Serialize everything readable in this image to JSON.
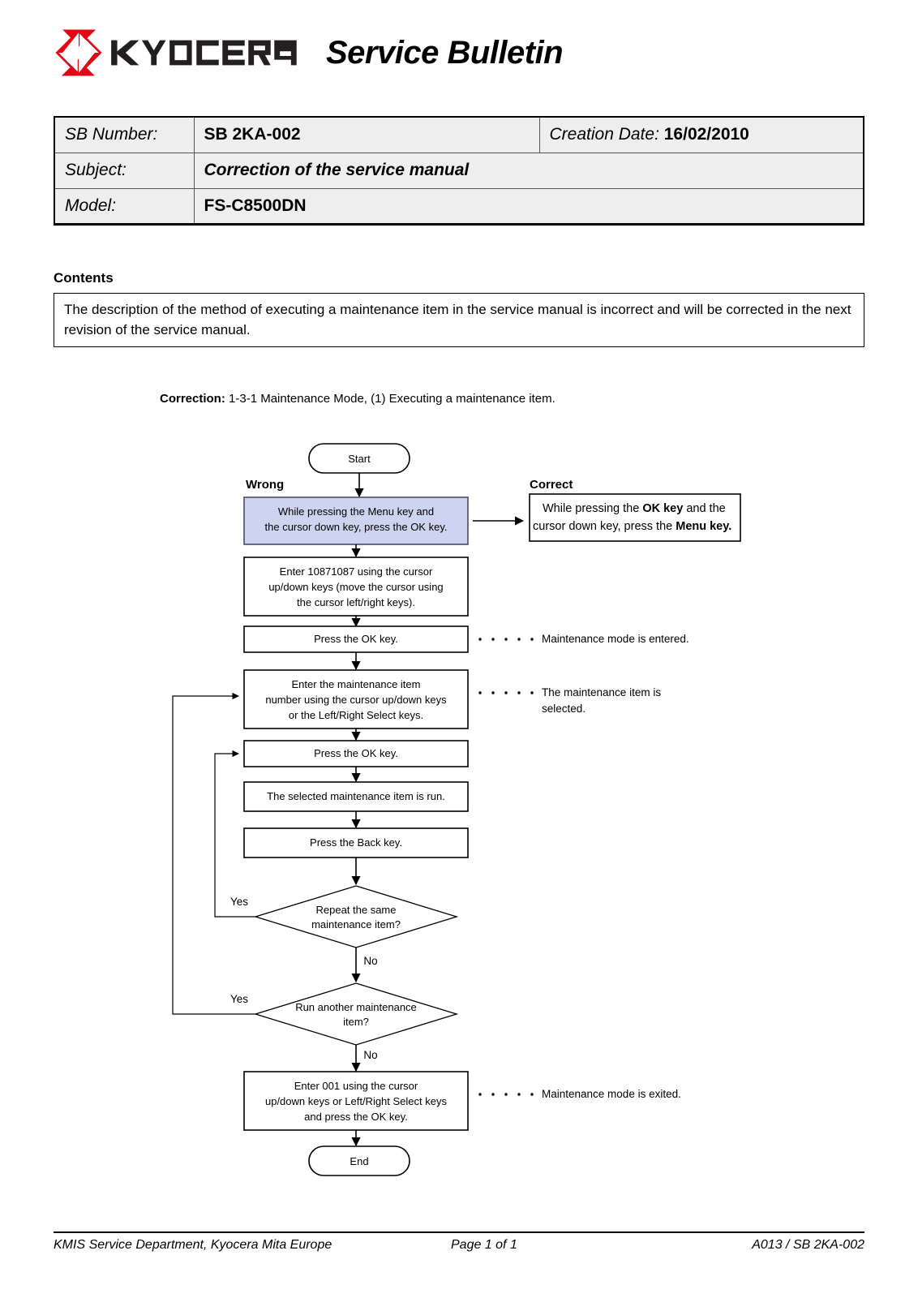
{
  "header": {
    "logo_name": "KYOCERA",
    "logo_color": "#e30613",
    "title": "Service Bulletin"
  },
  "info": {
    "sb_number_label": "SB Number:",
    "sb_number_value": "SB 2KA-002",
    "creation_date_label": "Creation Date:",
    "creation_date_value": "16/02/2010",
    "subject_label": "Subject:",
    "subject_value": "Correction of the service manual",
    "model_label": "Model:",
    "model_value": "FS-C8500DN"
  },
  "contents": {
    "heading": "Contents",
    "body": "The description of the method of executing a maintenance item in the service manual is incorrect and will be corrected in the next revision of the service manual."
  },
  "correction": {
    "label": "Correction:",
    "text": "1-3-1 Maintenance Mode, (1) Executing a maintenance item."
  },
  "flowchart": {
    "wrong_header": "Wrong",
    "correct_header": "Correct",
    "start_label": "Start",
    "end_label": "End",
    "wrong_box": {
      "line1": "While pressing the Menu key and",
      "line2": "the cursor down key, press the OK key.",
      "fill": "#ccd4f0"
    },
    "correct_box": {
      "line1_a": "While pressing the ",
      "line1_b": "OK key",
      "line1_c": " and the",
      "line2_a": "cursor down key, press the ",
      "line2_b": "Menu key."
    },
    "steps": [
      {
        "id": "enter-code",
        "lines": [
          "Enter 10871087 using the cursor",
          "up/down keys (move the cursor using",
          "the cursor left/right keys)."
        ]
      },
      {
        "id": "press-ok-1",
        "lines": [
          "Press the OK key."
        ],
        "note": [
          "Maintenance mode is entered."
        ]
      },
      {
        "id": "enter-item-number",
        "lines": [
          "Enter the maintenance item",
          "number using the cursor up/down keys",
          "or the Left/Right Select keys."
        ],
        "note": [
          "The maintenance item is",
          "selected."
        ]
      },
      {
        "id": "press-ok-2",
        "lines": [
          "Press the OK key."
        ]
      },
      {
        "id": "item-runs",
        "lines": [
          "The selected maintenance item is run."
        ]
      },
      {
        "id": "press-back",
        "lines": [
          "Press the Back key."
        ]
      },
      {
        "id": "exit-code",
        "lines": [
          "Enter 001 using the cursor",
          "up/down keys or Left/Right Select keys",
          "and press the OK key."
        ],
        "note": [
          "Maintenance mode is exited."
        ]
      }
    ],
    "decisions": [
      {
        "id": "repeat-same-item",
        "lines": [
          "Repeat the same",
          "maintenance item?"
        ],
        "yes_label": "Yes",
        "no_label": "No"
      },
      {
        "id": "run-another-item",
        "lines": [
          "Run another maintenance",
          "item?"
        ],
        "yes_label": "Yes",
        "no_label": "No"
      }
    ]
  },
  "footer": {
    "left": "KMIS Service Department, Kyocera Mita Europe",
    "center": "Page 1 of 1",
    "right": "A013 / SB 2KA-002"
  }
}
